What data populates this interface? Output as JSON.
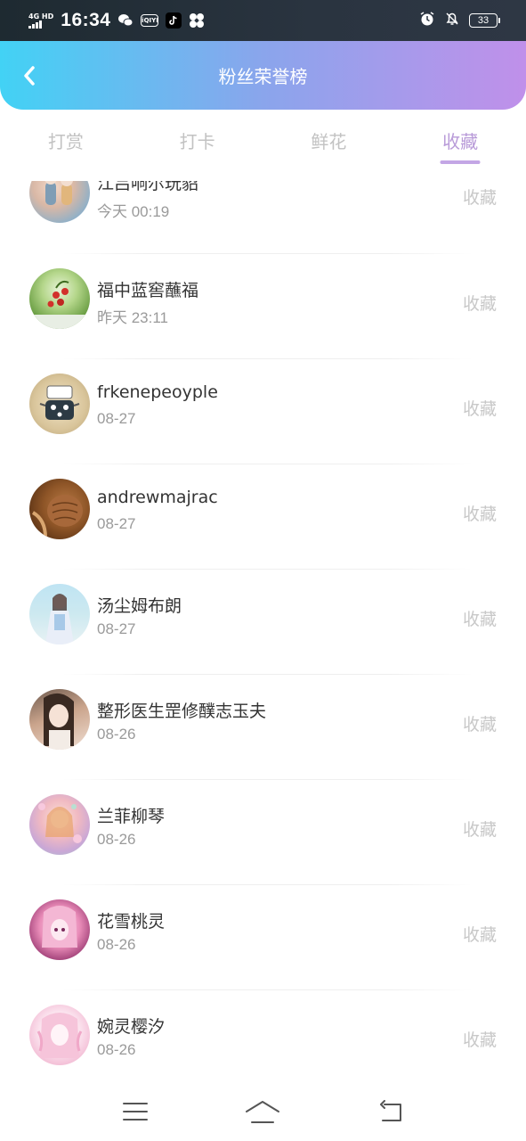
{
  "status_bar": {
    "network": "4G HD",
    "time": "16:34",
    "battery": "33"
  },
  "header": {
    "title": "粉丝荣誉榜"
  },
  "tabs": [
    {
      "label": "打赏",
      "active": false
    },
    {
      "label": "打卡",
      "active": false
    },
    {
      "label": "鲜花",
      "active": false
    },
    {
      "label": "收藏",
      "active": true
    }
  ],
  "list": [
    {
      "name": "江吕响尔玩貂",
      "time": "今天 00:19",
      "action": "收藏"
    },
    {
      "name": "福中蓝窖蘸福",
      "time": "昨天 23:11",
      "action": "收藏"
    },
    {
      "name": "frkenepeoyple",
      "time": "08-27",
      "action": "收藏"
    },
    {
      "name": "andrewmajrac",
      "time": "08-27",
      "action": "收藏"
    },
    {
      "name": "汤尘姆布朗",
      "time": "08-27",
      "action": "收藏"
    },
    {
      "name": "整形医生罡修醭志玉夫",
      "time": "08-26",
      "action": "收藏"
    },
    {
      "name": "兰菲柳琴",
      "time": "08-26",
      "action": "收藏"
    },
    {
      "name": "花雪桃灵",
      "time": "08-26",
      "action": "收藏"
    },
    {
      "name": "婉灵樱汐",
      "time": "08-26",
      "action": "收藏"
    }
  ],
  "colors": {
    "header_gradient_start": "#42d2f5",
    "header_gradient_end": "#c090ea",
    "tab_active": "#b89ad8",
    "action_text": "#c8c8c8"
  },
  "nav": {
    "menu_icon": "menu-icon",
    "home_icon": "home-icon",
    "back_icon": "return-icon"
  }
}
